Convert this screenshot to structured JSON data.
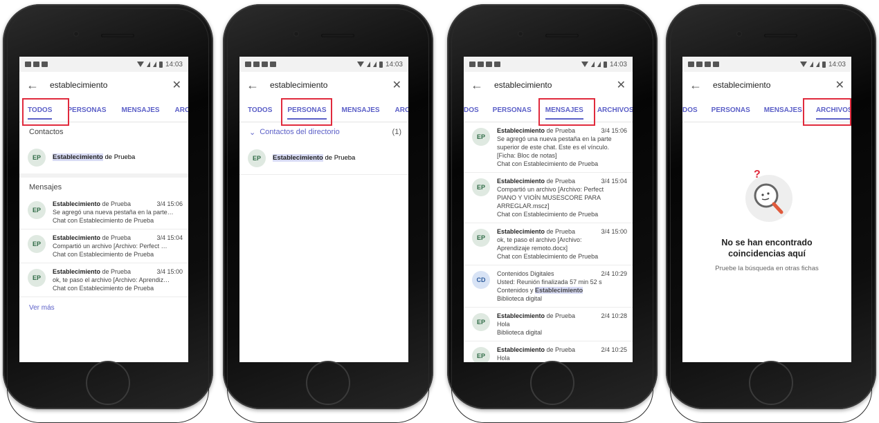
{
  "status_time": "14:03",
  "search_query": "establecimiento",
  "tabs": {
    "todos": "TODOS",
    "personas": "PERSONAS",
    "mensajes": "MENSAJES",
    "archivos": "ARCHIVOS",
    "archivos_cut": "ARCHIV",
    "todos_cut": "DOS"
  },
  "screen1": {
    "contacts_title": "Contactos",
    "contact": {
      "avatar": "EP",
      "highlight": "Establecimiento",
      "rest": " de Prueba"
    },
    "messages_title": "Mensajes",
    "messages": [
      {
        "avatar": "EP",
        "name_hl": "Establecimiento",
        "name_rest": " de Prueba",
        "date": "3/4 15:06",
        "preview": "Se agregó una nueva pestaña en la parte…",
        "chat": "Chat con Establecimiento de Prueba"
      },
      {
        "avatar": "EP",
        "name_hl": "Establecimiento",
        "name_rest": " de Prueba",
        "date": "3/4 15:04",
        "preview": "Compartió un archivo [Archivo: Perfect …",
        "chat": "Chat con Establecimiento de Prueba"
      },
      {
        "avatar": "EP",
        "name_hl": "Establecimiento",
        "name_rest": " de Prueba",
        "date": "3/4 15:00",
        "preview": "ok, te paso el archivo [Archivo: Aprendiz…",
        "chat": "Chat con Establecimiento de Prueba"
      }
    ],
    "see_more": "Ver más"
  },
  "screen2": {
    "group_title": "Contactos del directorio",
    "group_count": "(1)",
    "contact": {
      "avatar": "EP",
      "highlight": "Establecimiento",
      "rest": " de Prueba"
    }
  },
  "screen3": {
    "messages": [
      {
        "avatar": "EP",
        "name_hl": "Establecimiento",
        "name_rest": " de Prueba",
        "date": "3/4 15:06",
        "l1": "Se agregó una nueva pestaña en la parte",
        "l2": "superior de este chat. Este es el vínculo.",
        "l3": "[Ficha: Bloc de notas]",
        "l4": "Chat con Establecimiento de Prueba"
      },
      {
        "avatar": "EP",
        "name_hl": "Establecimiento",
        "name_rest": " de Prueba",
        "date": "3/4 15:04",
        "l1": "Compartió un archivo [Archivo: Perfect",
        "l2": "PIANO Y VIOÍN MUSESCORE PARA",
        "l3": "ARREGLAR.mscz]",
        "l4": "Chat con Establecimiento de Prueba"
      },
      {
        "avatar": "EP",
        "name_hl": "Establecimiento",
        "name_rest": " de Prueba",
        "date": "3/4 15:00",
        "l1": "ok, te paso el archivo [Archivo:",
        "l2": "Aprendizaje remoto.docx]",
        "l3": "Chat con Establecimiento de Prueba",
        "l4": ""
      },
      {
        "avatar": "CD",
        "name_plain": "Contenidos  Digitales",
        "date": "2/4 10:29",
        "l1": "Usted: Reunión finalizada 57 min 52 s",
        "l2a": "Contenidos y ",
        "l2hl": "Establecimiento",
        "l3": "Biblioteca digital"
      },
      {
        "avatar": "EP",
        "name_hl": "Establecimiento",
        "name_rest": " de Prueba",
        "date": "2/4 10:28",
        "l1": "Hola",
        "l2": "Biblioteca digital",
        "l3": "",
        "l4": ""
      },
      {
        "avatar": "EP",
        "name_hl": "Establecimiento",
        "name_rest": " de Prueba",
        "date": "2/4 10:25",
        "l1": "Hola",
        "l2": "",
        "l3": "",
        "l4": ""
      }
    ]
  },
  "screen4": {
    "empty_title_1": "No se han encontrado",
    "empty_title_2": "coincidencias aquí",
    "empty_sub": "Pruebe la búsqueda en otras fichas"
  },
  "colors": {
    "accent": "#5b5fc7",
    "highlight_box": "#e02a3c",
    "mark": "#d9dcf5"
  }
}
